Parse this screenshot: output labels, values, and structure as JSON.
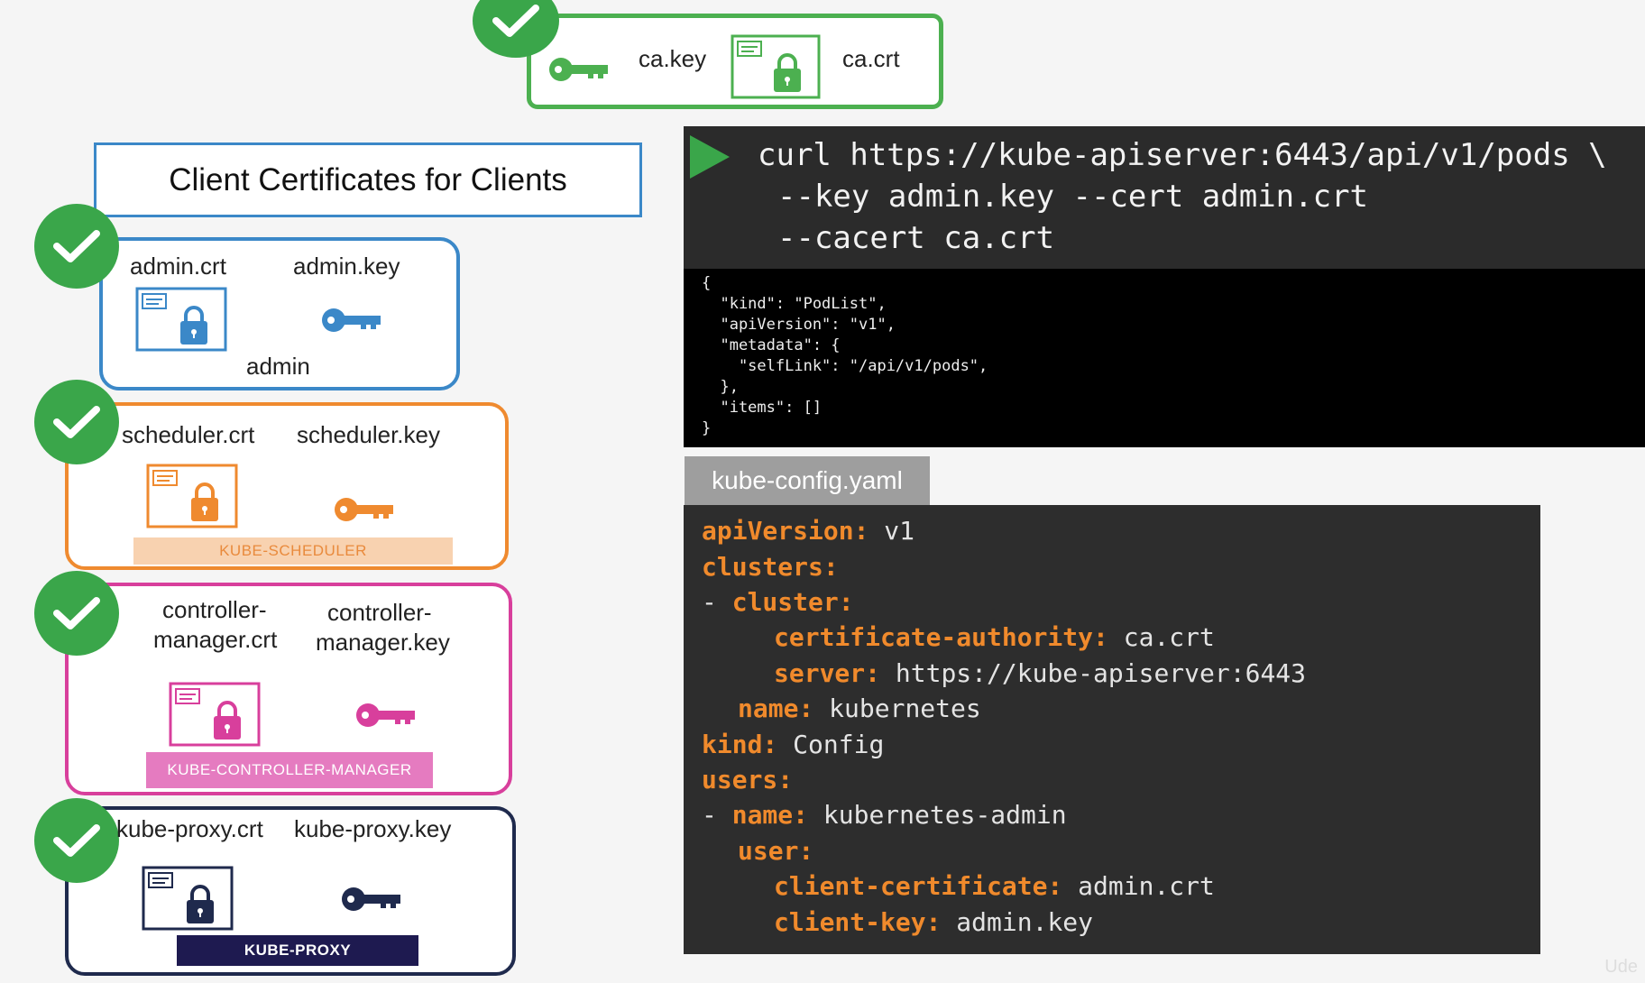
{
  "ca": {
    "key_label": "ca.key",
    "crt_label": "ca.crt",
    "color": "#4cb050"
  },
  "title": "Client Certificates for Clients",
  "clients": [
    {
      "crt": "admin.crt",
      "key": "admin.key",
      "name": "admin",
      "banner": "",
      "color": "#3b88c8"
    },
    {
      "crt": "scheduler.crt",
      "key": "scheduler.key",
      "banner": "KUBE-SCHEDULER",
      "color": "#ef8a2f"
    },
    {
      "crt_line1": "controller-",
      "crt_line2": "manager.crt",
      "key_line1": "controller-",
      "key_line2": "manager.key",
      "banner": "KUBE-CONTROLLER-MANAGER",
      "color": "#d83f9c"
    },
    {
      "crt": "kube-proxy.crt",
      "key": "kube-proxy.key",
      "banner": "KUBE-PROXY",
      "color": "#1f2a4d"
    }
  ],
  "curl": {
    "line1": "curl https://kube-apiserver:6443/api/v1/pods \\",
    "line2": "--key admin.key --cert admin.crt",
    "line3": "--cacert ca.crt"
  },
  "json_output": [
    "{",
    "  \"kind\": \"PodList\",",
    "  \"apiVersion\": \"v1\",",
    "  \"metadata\": {",
    "    \"selfLink\": \"/api/v1/pods\",",
    "  },",
    "  \"items\": []",
    "}"
  ],
  "yaml_tab": "kube-config.yaml",
  "yaml": {
    "l1k": "apiVersion:",
    "l1v": " v1",
    "l2k": "clusters:",
    "l3d": "- ",
    "l3k": "cluster:",
    "l4k": "certificate-authority:",
    "l4v": " ca.crt",
    "l5k": "server:",
    "l5v": " https://kube-apiserver:6443",
    "l6k": "name:",
    "l6v": " kubernetes",
    "l7k": "kind:",
    "l7v": " Config",
    "l8k": "users:",
    "l9d": "- ",
    "l9k": "name:",
    "l9v": " kubernetes-admin",
    "l10k": "user:",
    "l11k": "client-certificate:",
    "l11v": " admin.crt",
    "l12k": "client-key:",
    "l12v": " admin.key"
  },
  "watermark": "Ude",
  "icons": {
    "check": "check-icon",
    "cert": "certificate-icon",
    "key": "key-icon",
    "play": "play-icon"
  }
}
